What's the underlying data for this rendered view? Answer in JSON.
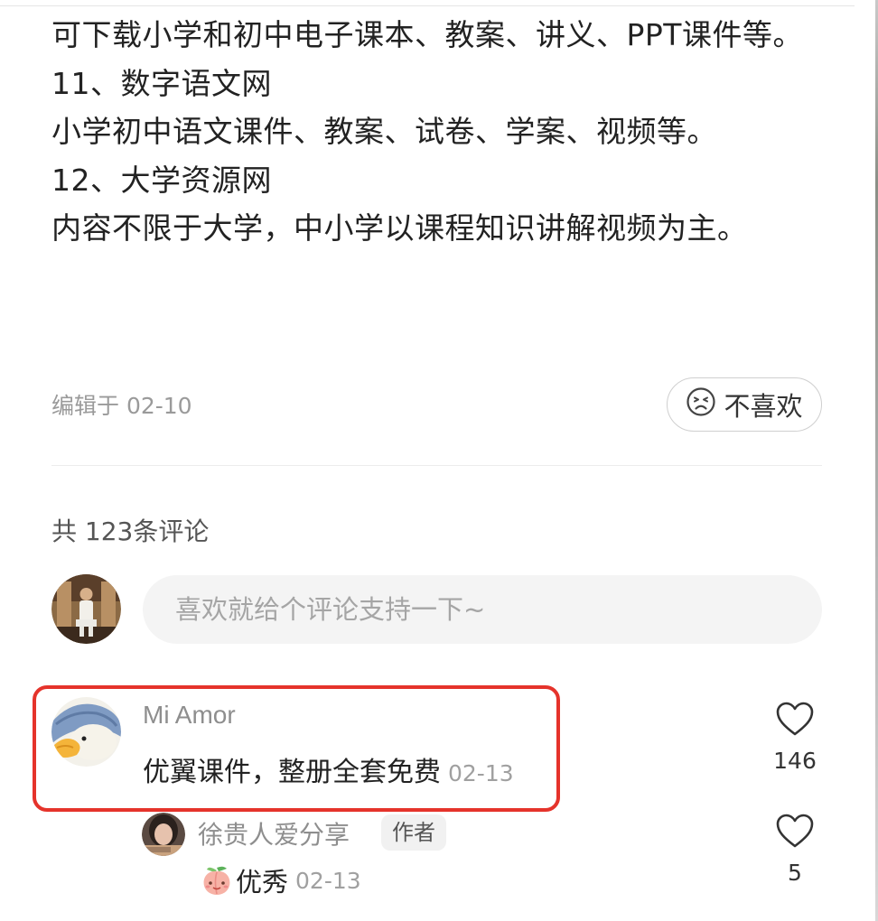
{
  "article": {
    "lines": [
      "可下载小学和初中电子课本、教案、讲义、PPT课件等。",
      "11、数字语文网",
      "小学初中语文课件、教案、试卷、学案、视频等。",
      "12、大学资源网",
      "内容不限于大学，中小学以课程知识讲解视频为主。"
    ],
    "edited_text": "编辑于 02-10",
    "dislike_label": "不喜欢"
  },
  "comments_header": {
    "count_text": "共 123条评论",
    "input_placeholder": "喜欢就给个评论支持一下~"
  },
  "comments": [
    {
      "author": "Mi Amor",
      "text": "优翼课件，整册全套免费",
      "date": "02-13",
      "likes": "146",
      "replies": [
        {
          "author": "徐贵人爱分享",
          "badge": "作者",
          "text": "优秀",
          "date": "02-13",
          "likes": "5"
        }
      ]
    }
  ],
  "colors": {
    "highlight": "#e5332b",
    "input_bg": "#f4f4f4",
    "meta_text": "#9a9a9a"
  },
  "icons": [
    "frown-emoji-icon",
    "heart-outline-icon",
    "peach-emoji-icon"
  ]
}
